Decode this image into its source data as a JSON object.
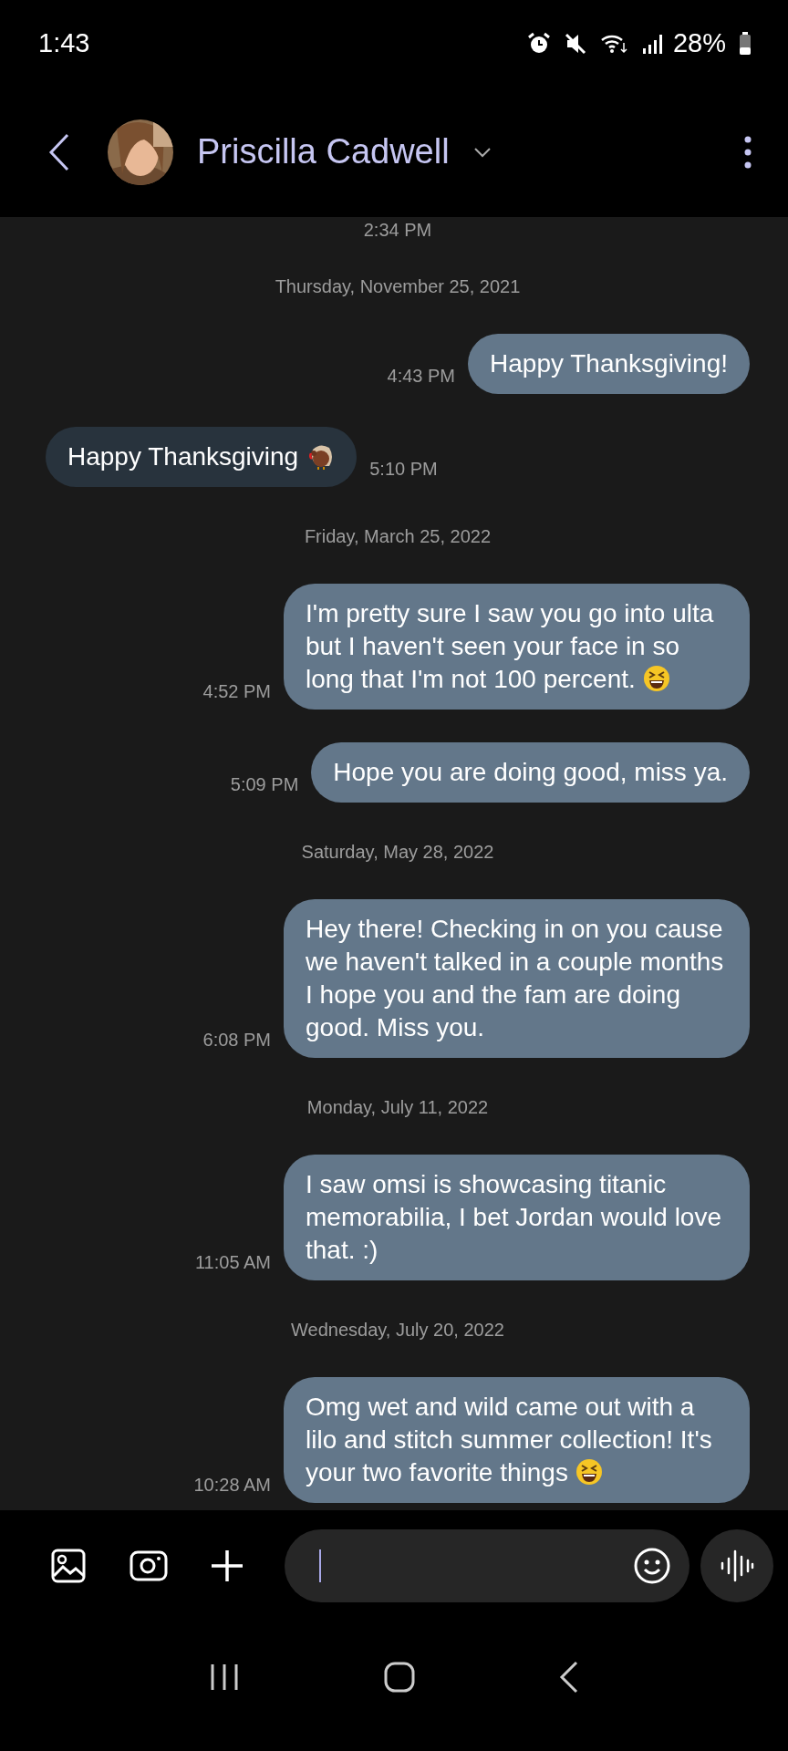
{
  "status_bar": {
    "time": "1:43",
    "battery": "28%"
  },
  "header": {
    "contact_name": "Priscilla Cadwell"
  },
  "conversation": [
    {
      "kind": "time",
      "text": "2:34 PM"
    },
    {
      "kind": "date",
      "text": "Thursday, November 25, 2021"
    },
    {
      "kind": "sent",
      "text": "Happy Thanksgiving!",
      "time": "4:43 PM"
    },
    {
      "kind": "received",
      "text": "Happy Thanksgiving",
      "emoji": {
        "kind": "turkey"
      },
      "time": "5:10 PM"
    },
    {
      "kind": "date",
      "text": "Friday, March 25, 2022"
    },
    {
      "kind": "sent",
      "text": "I'm pretty sure I saw you go into ulta but I haven't seen your face in so long that I'm not 100 percent.",
      "emoji": {
        "kind": "laughing"
      },
      "time": "4:52 PM"
    },
    {
      "kind": "sent",
      "text": "Hope you are doing good, miss ya.",
      "time": "5:09 PM"
    },
    {
      "kind": "date",
      "text": "Saturday, May 28, 2022"
    },
    {
      "kind": "sent",
      "text": "Hey there! Checking in on you cause we haven't talked in a couple months I hope you and the fam are doing good. Miss you.",
      "time": "6:08 PM"
    },
    {
      "kind": "date",
      "text": "Monday, July 11, 2022"
    },
    {
      "kind": "sent",
      "text": "I saw omsi is showcasing titanic memorabilia, I bet Jordan would love that. :)",
      "time": "11:05 AM"
    },
    {
      "kind": "date",
      "text": "Wednesday, July 20, 2022"
    },
    {
      "kind": "sent",
      "text": "Omg wet and wild came out with a lilo and stitch summer collection! It's your two favorite things",
      "emoji": {
        "kind": "laughing"
      },
      "time": "10:28 AM"
    }
  ]
}
